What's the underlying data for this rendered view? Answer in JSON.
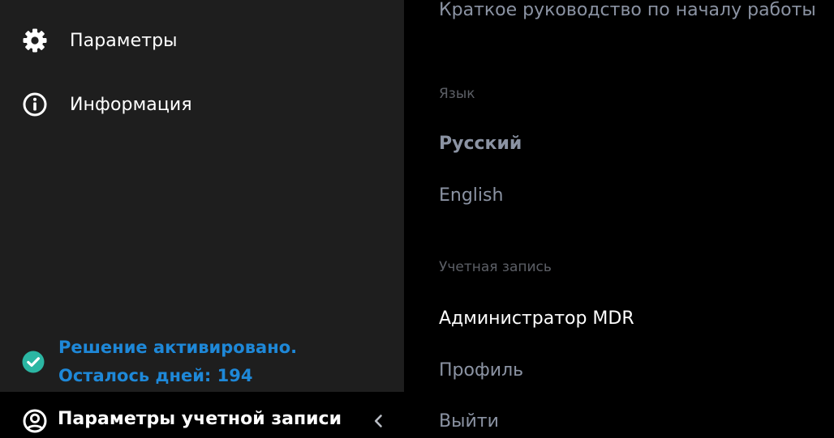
{
  "sidebar": {
    "items": [
      {
        "label": "Параметры",
        "icon": "gear-icon"
      },
      {
        "label": "Информация",
        "icon": "info-icon"
      }
    ],
    "status": {
      "line1": "Решение активировано.",
      "line2": "Осталось дней: 194",
      "icon": "check-circle-icon",
      "color": "#1e88d8",
      "icon_color": "#2bb6a3"
    },
    "account": {
      "label": "Параметры учетной записи",
      "icon": "user-circle-icon",
      "collapse_icon": "chevron-left-icon"
    }
  },
  "panel": {
    "quickstart": "Краткое руководство по началу работы",
    "language_header": "Язык",
    "languages": [
      {
        "label": "Русский",
        "selected": true
      },
      {
        "label": "English",
        "selected": false
      }
    ],
    "account_header": "Учетная запись",
    "account_name": "Администратор MDR",
    "profile": "Профиль",
    "logout": "Выйти"
  }
}
